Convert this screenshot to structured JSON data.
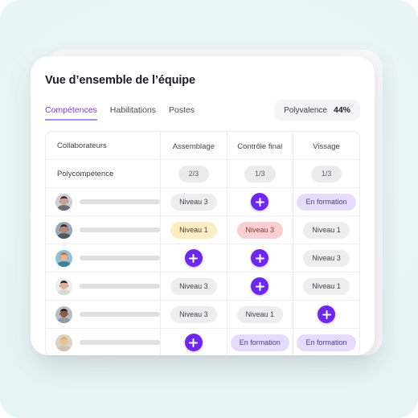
{
  "header": {
    "title": "Vue d’ensemble de l’équipe"
  },
  "tabs": [
    {
      "label": "Compétences",
      "active": true
    },
    {
      "label": "Habilitations",
      "active": false
    },
    {
      "label": "Postes",
      "active": false
    }
  ],
  "polyvalence": {
    "label": "Polyvalence",
    "value": "44%"
  },
  "table": {
    "columns": [
      "Collaborateurs",
      "Assemblage",
      "Contrôle final",
      "Vissage"
    ],
    "summary_row": {
      "label": "Polycompétence",
      "values": [
        "2/3",
        "1/3",
        "1/3"
      ]
    },
    "rows": [
      {
        "avatar": "avatar-1",
        "cells": [
          {
            "type": "pill",
            "style": "grey",
            "label": "Niveau 3"
          },
          {
            "type": "plus",
            "style": "plus",
            "label": "+"
          },
          {
            "type": "pill",
            "style": "purple",
            "label": "En formation"
          }
        ]
      },
      {
        "avatar": "avatar-2",
        "cells": [
          {
            "type": "pill",
            "style": "yellow",
            "label": "Niveau 1"
          },
          {
            "type": "pill",
            "style": "red",
            "label": "Niveau 3"
          },
          {
            "type": "pill",
            "style": "grey",
            "label": "Niveau 1"
          }
        ]
      },
      {
        "avatar": "avatar-3",
        "cells": [
          {
            "type": "plus",
            "style": "plus",
            "label": "+"
          },
          {
            "type": "plus",
            "style": "plus",
            "label": "+"
          },
          {
            "type": "pill",
            "style": "grey",
            "label": "Niveau 3"
          }
        ]
      },
      {
        "avatar": "avatar-4",
        "cells": [
          {
            "type": "pill",
            "style": "grey",
            "label": "Niveau 3"
          },
          {
            "type": "plus",
            "style": "plus",
            "label": "+"
          },
          {
            "type": "pill",
            "style": "grey",
            "label": "Niveau 1"
          }
        ]
      },
      {
        "avatar": "avatar-5",
        "cells": [
          {
            "type": "pill",
            "style": "grey",
            "label": "Niveau 3"
          },
          {
            "type": "pill",
            "style": "grey",
            "label": "Niveau 1"
          },
          {
            "type": "plus",
            "style": "plus",
            "label": "+"
          }
        ]
      },
      {
        "avatar": "avatar-6",
        "cells": [
          {
            "type": "plus",
            "style": "plus",
            "label": "+"
          },
          {
            "type": "pill",
            "style": "purple",
            "label": "En formation"
          },
          {
            "type": "pill",
            "style": "purple",
            "label": "En formation"
          }
        ]
      }
    ]
  },
  "colors": {
    "background": "#e9f6f5",
    "card": "#ffffff",
    "accent": "#7c3aed",
    "accent_button": "#6d28f0",
    "pill_grey": "#eeeeef",
    "pill_yellow": "#fbeec2",
    "pill_red": "#f9cfcf",
    "pill_purple": "#e5dcfb",
    "grid_line": "#ece9f7"
  },
  "avatar_palettes": {
    "avatar-1": {
      "bg": "#cfcfd6",
      "skin": "#c8a288",
      "hair": "#3a2d2a",
      "cloth": "#6d6d78"
    },
    "avatar-2": {
      "bg": "#9aa7bb",
      "skin": "#b9886a",
      "hair": "#2e2622",
      "cloth": "#4d5869"
    },
    "avatar-3": {
      "bg": "#8fc2d6",
      "skin": "#e3b396",
      "hair": "#c4693a",
      "cloth": "#3f7f99"
    },
    "avatar-4": {
      "bg": "#ededee",
      "skin": "#dfb195",
      "hair": "#241c1a",
      "cloth": "#d7d7da"
    },
    "avatar-5": {
      "bg": "#b5bdc6",
      "skin": "#8a5c3d",
      "hair": "#1f1714",
      "cloth": "#8e9aa6"
    },
    "avatar-6": {
      "bg": "#ddd2c4",
      "skin": "#e6c0a2",
      "hair": "#d8b370",
      "cloth": "#cfc2b2"
    }
  }
}
